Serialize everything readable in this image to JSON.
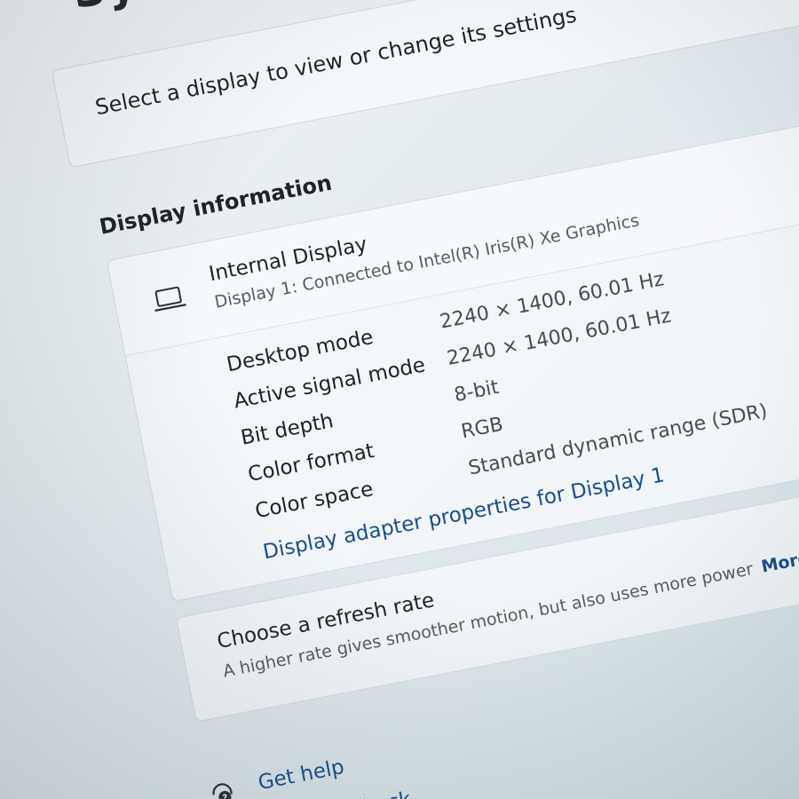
{
  "page": {
    "title": "System"
  },
  "select_card": {
    "text": "Select a display to view or change its settings"
  },
  "display_information": {
    "heading": "Display information",
    "display_name": "Internal Display",
    "display_subtitle": "Display 1: Connected to Intel(R) Iris(R) Xe Graphics",
    "icon": "laptop-icon",
    "rows": [
      {
        "label": "Desktop mode",
        "value": "2240 × 1400, 60.01 Hz"
      },
      {
        "label": "Active signal mode",
        "value": "2240 × 1400, 60.01 Hz"
      },
      {
        "label": "Bit depth",
        "value": "8-bit"
      },
      {
        "label": "Color format",
        "value": "RGB"
      },
      {
        "label": "Color space",
        "value": "Standard dynamic range (SDR)"
      }
    ],
    "adapter_link": "Display adapter properties for Display 1"
  },
  "refresh_card": {
    "title": "Choose a refresh rate",
    "description": "A higher rate gives smoother motion, but also uses more power",
    "more_link": "More abo"
  },
  "footer": {
    "help_icon": "help-chat-icon",
    "get_help": "Get help",
    "feedback": "Give feedback"
  },
  "colors": {
    "link": "#1a4d8f",
    "background": "#e4ecf0",
    "text": "#1f2328"
  }
}
